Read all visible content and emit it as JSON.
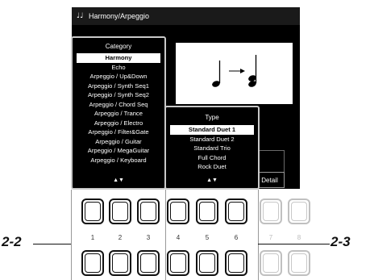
{
  "screen": {
    "title": "Harmony/Arpeggio",
    "title_icon": "keyboard-music-icon",
    "detail_label": "Detail"
  },
  "category": {
    "header": "Category",
    "items": [
      "Harmony",
      "Echo",
      "Arpeggio / Up&Down",
      "Arpeggio / Synth Seq1",
      "Arpeggio / Synth Seq2",
      "Arpeggio / Chord Seq",
      "Arpeggio / Trance",
      "Arpeggio / Electro",
      "Arpeggio / Filter&Gate",
      "Arpeggio / Guitar",
      "Arpeggio / MegaGuitar",
      "Arpeggio / Keyboard"
    ],
    "selected_index": 0,
    "scroll_arrows": "▲▼"
  },
  "type": {
    "header": "Type",
    "items": [
      "Standard Duet 1",
      "Standard Duet 2",
      "Standard Trio",
      "Full Chord",
      "Rock Duet"
    ],
    "selected_index": 0,
    "scroll_arrows": "▲▼"
  },
  "buttons": {
    "numbers": [
      "1",
      "2",
      "3",
      "4",
      "5",
      "6",
      "7",
      "8"
    ]
  },
  "callouts": {
    "left": "2-2",
    "right": "2-3"
  },
  "colors": {
    "screen_bg": "#000000",
    "selected_bg": "#ffffff",
    "text": "#ffffff"
  }
}
